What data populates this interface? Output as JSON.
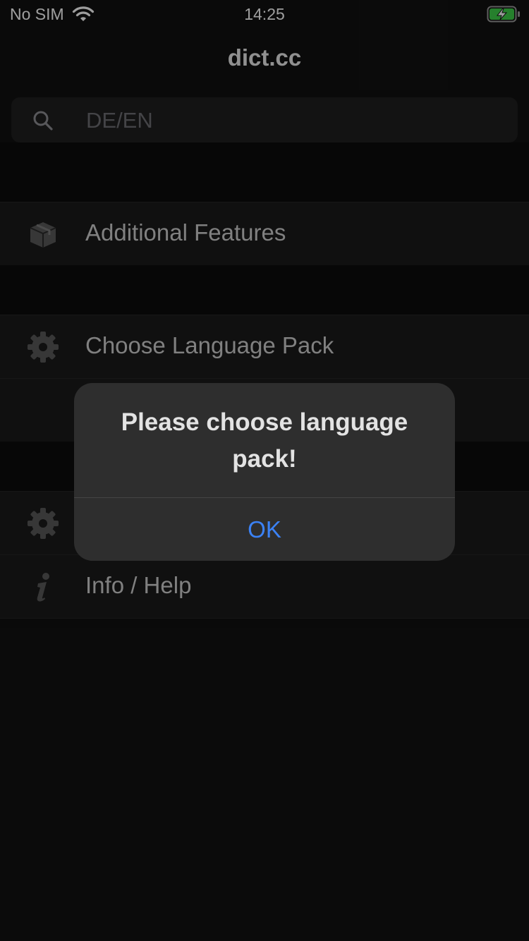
{
  "status_bar": {
    "carrier": "No SIM",
    "time": "14:25",
    "wifi_icon": "wifi-icon",
    "battery_icon": "battery-charging-icon",
    "battery_color": "#3ecf4a"
  },
  "nav": {
    "title": "dict.cc"
  },
  "search": {
    "placeholder": "DE/EN",
    "value": "",
    "icon": "search-icon"
  },
  "list": {
    "items": [
      {
        "label": "Additional Features",
        "icon": "package-icon"
      },
      {
        "label": "Choose Language Pack",
        "icon": "gear-icon"
      },
      {
        "label": "",
        "icon": ""
      },
      {
        "label": "",
        "icon": "gear-icon"
      },
      {
        "label": "Info / Help",
        "icon": "info-icon"
      }
    ]
  },
  "alert": {
    "message": "Please choose language pack!",
    "ok_label": "OK",
    "accent": "#3b82f6"
  }
}
